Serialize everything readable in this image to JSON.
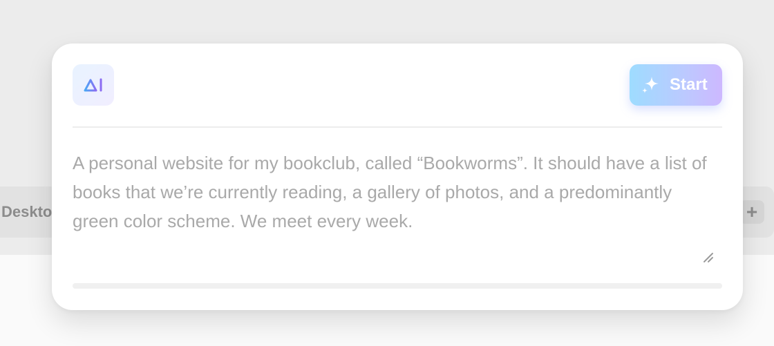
{
  "background": {
    "tab_label": "Desktop",
    "add_tab_icon": "plus-icon",
    "add_tab_symbol": "+"
  },
  "card": {
    "logo_icon": "ai-logo-icon",
    "start_button": {
      "label": "Start",
      "icon": "sparkle-icon"
    },
    "prompt": "A personal website for my bookclub, called “Bookworms”. It should have a list of books that we’re currently reading, a gallery of photos, and a predominantly green color scheme. We meet every week.",
    "resize_icon": "resize-handle-icon",
    "progress": 0
  },
  "colors": {
    "gradient_start": "#9edcff",
    "gradient_end": "#cdb8ff",
    "placeholder_text": "#a9a9a9"
  }
}
